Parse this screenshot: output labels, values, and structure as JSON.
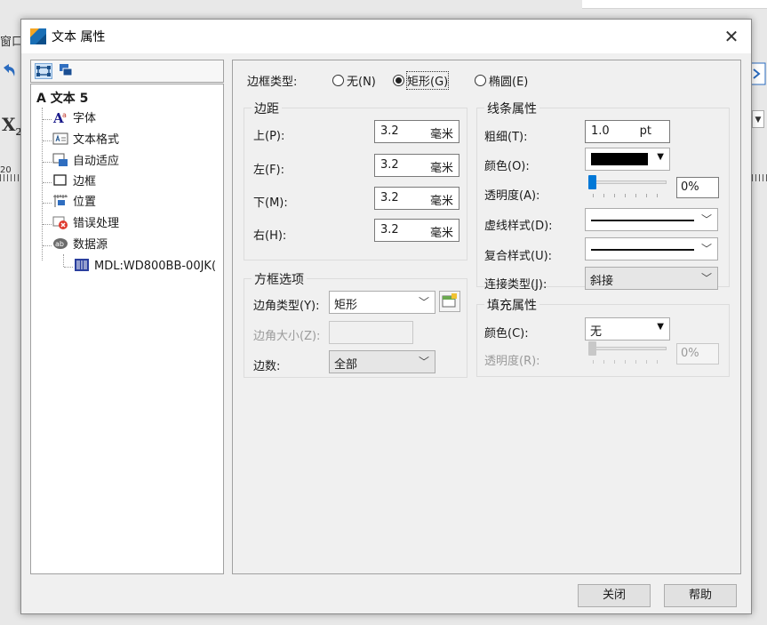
{
  "background": {
    "fragment_menu": "窗口(",
    "fragment_font": "X",
    "fragment_font_sub": "2",
    "fragment_ruler": "20"
  },
  "dialog": {
    "title": "文本 属性",
    "close_glyph": "✕"
  },
  "tree": {
    "root": "A 文本 5",
    "items": [
      {
        "label": "字体",
        "icon": "font-icon"
      },
      {
        "label": "文本格式",
        "icon": "text-format-icon"
      },
      {
        "label": "自动适应",
        "icon": "auto-fit-icon"
      },
      {
        "label": "边框",
        "icon": "border-icon"
      },
      {
        "label": "位置",
        "icon": "position-icon"
      },
      {
        "label": "错误处理",
        "icon": "error-handling-icon"
      },
      {
        "label": "数据源",
        "icon": "datasource-icon"
      }
    ],
    "datasource_child": "MDL:WD800BB-00JK("
  },
  "frame_type": {
    "label": "边框类型:",
    "options": [
      "无(N)",
      "矩形(G)",
      "椭圆(E)"
    ],
    "selected": "矩形(G)"
  },
  "margins": {
    "title": "边距",
    "unit": "毫米",
    "rows": [
      {
        "label": "上(P):",
        "value": "3.2"
      },
      {
        "label": "左(F):",
        "value": "3.2"
      },
      {
        "label": "下(M):",
        "value": "3.2"
      },
      {
        "label": "右(H):",
        "value": "3.2"
      }
    ]
  },
  "box_options": {
    "title": "方框选项",
    "corner_type_label": "边角类型(Y):",
    "corner_type_value": "矩形",
    "corner_size_label": "边角大小(Z):",
    "edges_label": "边数:",
    "edges_value": "全部"
  },
  "line_props": {
    "title": "线条属性",
    "thickness_label": "粗细(T):",
    "thickness_value": "1.0",
    "thickness_unit": "pt",
    "color_label": "颜色(O):",
    "color_value": "#000000",
    "transparency_label": "透明度(A):",
    "transparency_value": "0%",
    "transparency_level": 0,
    "dash_label": "虚线样式(D):",
    "compound_label": "复合样式(U):",
    "join_label": "连接类型(J):",
    "join_value": "斜接"
  },
  "fill_props": {
    "title": "填充属性",
    "color_label": "颜色(C):",
    "color_value": "无",
    "transparency_label": "透明度(R):",
    "transparency_value": "0%",
    "transparency_level": 0
  },
  "buttons": {
    "close": "关闭",
    "help": "帮助"
  },
  "colors": {
    "accent": "#0078d7",
    "border": "#a0a0a0"
  }
}
